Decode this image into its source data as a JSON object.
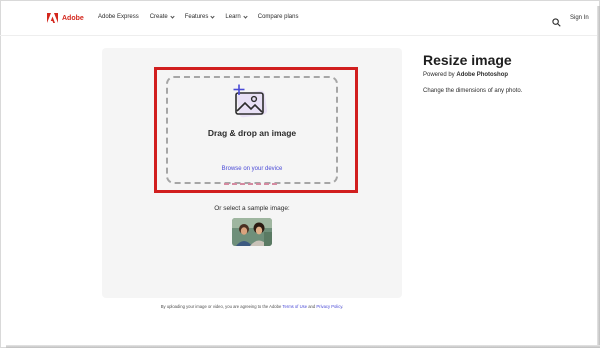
{
  "header": {
    "brand": "Adobe",
    "nav": [
      {
        "label": "Adobe Express",
        "has_menu": false
      },
      {
        "label": "Create",
        "has_menu": true
      },
      {
        "label": "Features",
        "has_menu": true
      },
      {
        "label": "Learn",
        "has_menu": true
      },
      {
        "label": "Compare plans",
        "has_menu": false
      }
    ],
    "search_icon": "search-icon",
    "sign_in": "Sign In"
  },
  "uploader": {
    "icon": "image-add-icon",
    "title": "Drag & drop an image",
    "browse_link": "Browse on your device",
    "sample_label": "Or select a sample image:",
    "highlight_color": "#d11f1f"
  },
  "legal": {
    "prefix": "By uploading your image or video, you are agreeing to the Adobe ",
    "terms": "Terms of Use",
    "middle": " and ",
    "privacy": "Privacy Policy",
    "suffix": "."
  },
  "info": {
    "title": "Resize image",
    "powered_prefix": "Powered by ",
    "powered_product": "Adobe Photoshop",
    "description": "Change the dimensions of any photo."
  },
  "colors": {
    "brand_red": "#d4271d",
    "link": "#4a4ad6",
    "panel_bg": "#f5f5f5"
  }
}
